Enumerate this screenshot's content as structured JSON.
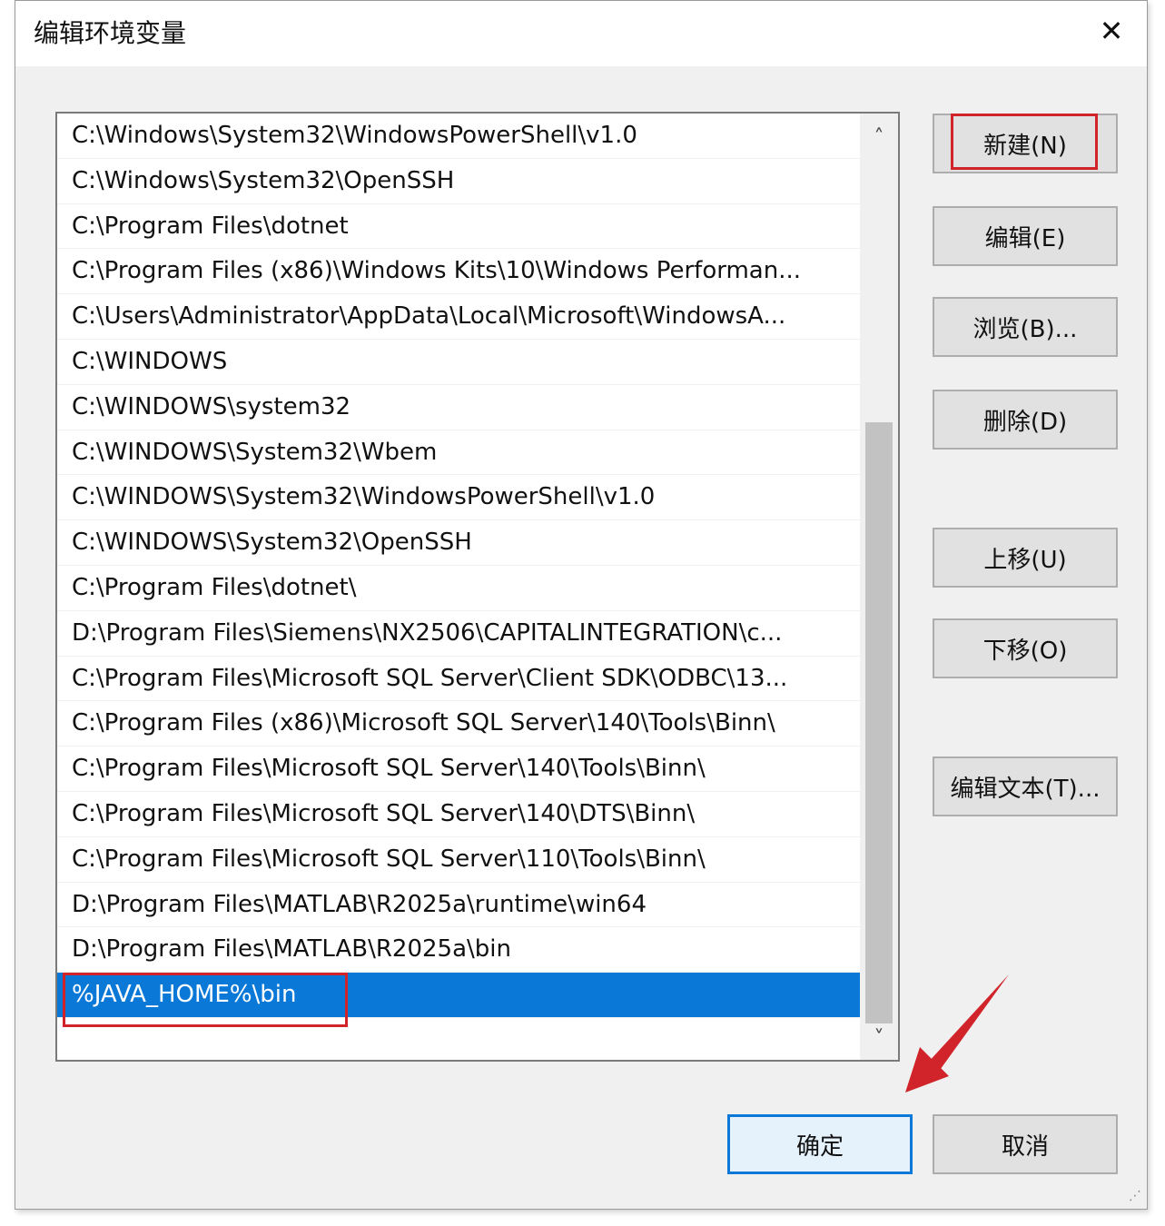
{
  "window": {
    "title": "编辑环境变量",
    "close_glyph": "✕"
  },
  "path_list": {
    "items": [
      "C:\\Windows\\System32\\WindowsPowerShell\\v1.0",
      "C:\\Windows\\System32\\OpenSSH",
      "C:\\Program Files\\dotnet",
      "C:\\Program Files (x86)\\Windows Kits\\10\\Windows Performan...",
      "C:\\Users\\Administrator\\AppData\\Local\\Microsoft\\WindowsA...",
      "C:\\WINDOWS",
      "C:\\WINDOWS\\system32",
      "C:\\WINDOWS\\System32\\Wbem",
      "C:\\WINDOWS\\System32\\WindowsPowerShell\\v1.0",
      "C:\\WINDOWS\\System32\\OpenSSH",
      "C:\\Program Files\\dotnet\\",
      "D:\\Program Files\\Siemens\\NX2506\\CAPITALINTEGRATION\\c...",
      "C:\\Program Files\\Microsoft SQL Server\\Client SDK\\ODBC\\13...",
      "C:\\Program Files (x86)\\Microsoft SQL Server\\140\\Tools\\Binn\\",
      "C:\\Program Files\\Microsoft SQL Server\\140\\Tools\\Binn\\",
      "C:\\Program Files\\Microsoft SQL Server\\140\\DTS\\Binn\\",
      "C:\\Program Files\\Microsoft SQL Server\\110\\Tools\\Binn\\",
      "D:\\Program Files\\MATLAB\\R2025a\\runtime\\win64",
      "D:\\Program Files\\MATLAB\\R2025a\\bin",
      "%JAVA_HOME%\\bin"
    ],
    "selected_index": 19
  },
  "scrollbar": {
    "up_glyph": "˄",
    "down_glyph": "˅"
  },
  "buttons": {
    "new": "新建(N)",
    "edit": "编辑(E)",
    "browse": "浏览(B)...",
    "delete": "删除(D)",
    "move_up": "上移(U)",
    "move_down": "下移(O)",
    "edit_text": "编辑文本(T)...",
    "ok": "确定",
    "cancel": "取消"
  },
  "colors": {
    "selection": "#0a78d7",
    "annotation": "#d0232a"
  }
}
